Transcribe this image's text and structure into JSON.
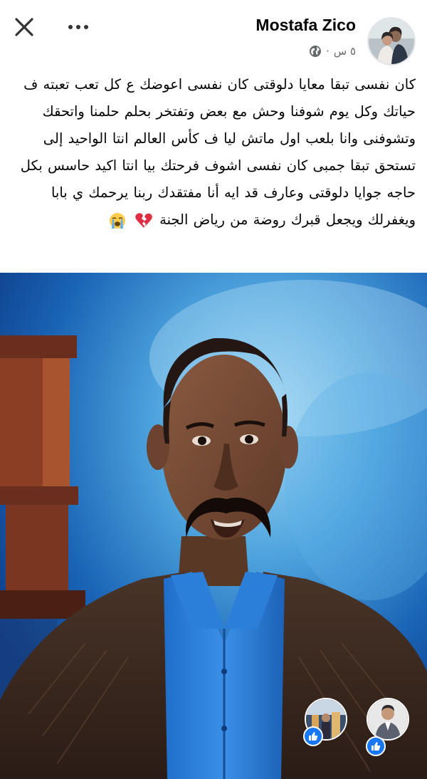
{
  "header": {
    "close_icon": "close-icon",
    "more_icon": "more-dots-icon",
    "author_name": "Mostafa Zico",
    "time": "٥ س",
    "separator": "·",
    "privacy_icon": "globe-icon"
  },
  "post": {
    "text": "كان نفسى تبقا معايا دلوقتى كان نفسى اعوضك ع كل تعب تعبته ف حياتك وكل يوم شوفنا وحش مع بعض وتفتخر بحلم حلمنا واتحقك وتشوفنى وانا بلعب اول ماتش ليا ف كأس العالم انتا الواحيد إلى تستحق تبقا جمبى كان نفسى اشوف فرحتك بيا انتا اكيد حاسس بكل حاجه جوايا دلوقتى وعارف قد ايه أنا مفتقدك ربنا يرحمك ي بابا ويغفرلك ويجعل قبرك روضة من رياض الجنة",
    "emojis": [
      "broken-heart-emoji",
      "crying-face-emoji"
    ]
  },
  "photo": {
    "description_icon": "photo-portrait"
  },
  "reactions": {
    "items": [
      {
        "type": "like",
        "icon": "like-thumb-icon"
      },
      {
        "type": "like",
        "icon": "like-thumb-icon"
      }
    ]
  },
  "colors": {
    "like_blue": "#1877f2",
    "meta_gray": "#65676b",
    "text": "#050505"
  }
}
